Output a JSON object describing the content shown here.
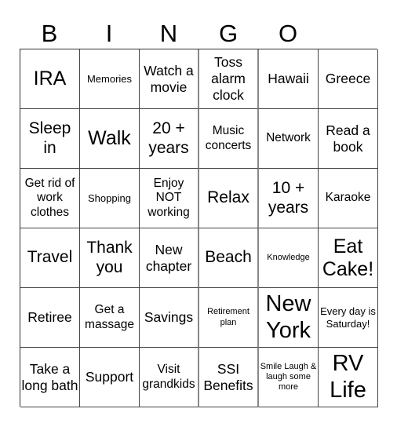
{
  "header": {
    "letters": [
      "B",
      "I",
      "N",
      "G",
      "O"
    ]
  },
  "cells": [
    [
      "IRA",
      "Memories",
      "Watch a movie",
      "Toss alarm clock",
      "Hawaii",
      "Greece"
    ],
    [
      "Sleep in",
      "Walk",
      "20 + years",
      "Music concerts",
      "Network",
      "Read a book"
    ],
    [
      "Get rid of work clothes",
      "Shopping",
      "Enjoy NOT working",
      "Relax",
      "10 + years",
      "Karaoke"
    ],
    [
      "Travel",
      "Thank you",
      "New chapter",
      "Beach",
      "Knowledge",
      "Eat Cake!"
    ],
    [
      "Retiree",
      "Get a massage",
      "Savings",
      "Retirement plan",
      "New York",
      "Every day is Saturday!"
    ],
    [
      "Take a long bath",
      "Support",
      "Visit grandkids",
      "SSI Benefits",
      "Smile Laugh & laugh some more",
      "RV Life"
    ]
  ]
}
